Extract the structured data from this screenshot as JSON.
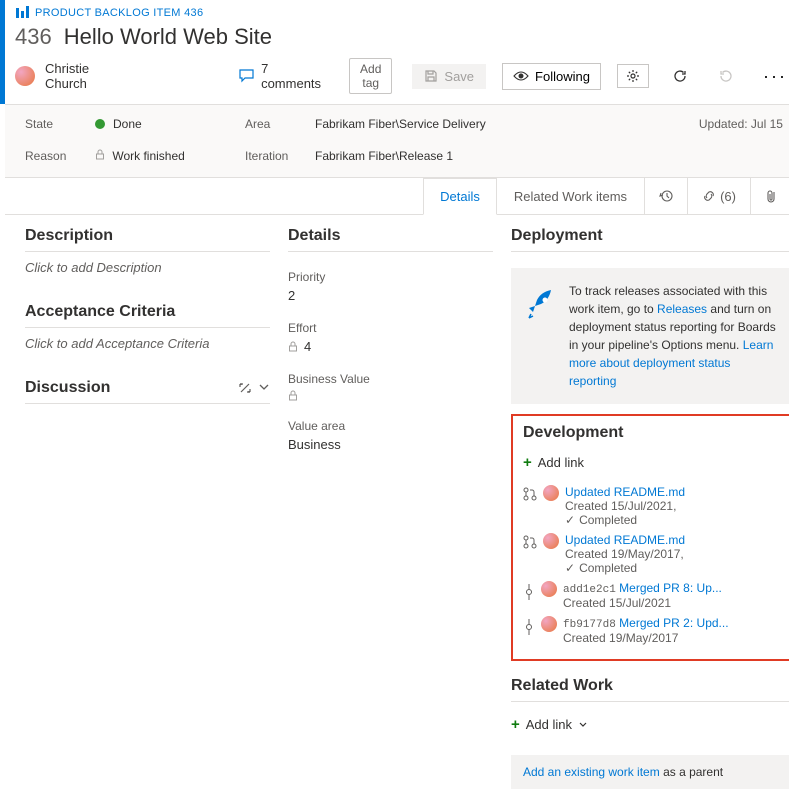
{
  "header": {
    "type_label": "PRODUCT BACKLOG ITEM 436",
    "id": "436",
    "title": "Hello World Web Site",
    "author": "Christie Church",
    "comments_count": "7 comments",
    "add_tag": "Add tag",
    "save": "Save",
    "following": "Following"
  },
  "fields": {
    "state_label": "State",
    "state_value": "Done",
    "reason_label": "Reason",
    "reason_value": "Work finished",
    "area_label": "Area",
    "area_value": "Fabrikam Fiber\\Service Delivery",
    "iteration_label": "Iteration",
    "iteration_value": "Fabrikam Fiber\\Release 1",
    "updated": "Updated: Jul 15"
  },
  "tabs": {
    "details": "Details",
    "related": "Related Work items",
    "links_count": "(6)"
  },
  "left": {
    "description_title": "Description",
    "description_placeholder": "Click to add Description",
    "acceptance_title": "Acceptance Criteria",
    "acceptance_placeholder": "Click to add Acceptance Criteria",
    "discussion_title": "Discussion"
  },
  "mid": {
    "title": "Details",
    "priority_label": "Priority",
    "priority_value": "2",
    "effort_label": "Effort",
    "effort_value": "4",
    "bv_label": "Business Value",
    "va_label": "Value area",
    "va_value": "Business"
  },
  "right": {
    "deployment_title": "Deployment",
    "deployment_text_1": "To track releases associated with this work item, go to ",
    "deployment_link_1": "Releases",
    "deployment_text_2": " and turn on deployment status reporting for Boards in your pipeline's Options menu. ",
    "deployment_link_2": "Learn more about deployment status reporting",
    "development_title": "Development",
    "add_link": "Add link",
    "items": [
      {
        "title": "Updated README.md",
        "created": "Created 15/Jul/2021,",
        "status": "Completed",
        "type": "pr"
      },
      {
        "title": "Updated README.md",
        "created": "Created 19/May/2017,",
        "status": "Completed",
        "type": "pr"
      },
      {
        "hash": "add1e2c1",
        "title": "Merged PR 8: Up...",
        "created": "Created 15/Jul/2021",
        "type": "commit"
      },
      {
        "hash": "fb9177d8",
        "title": "Merged PR 2: Upd...",
        "created": "Created 19/May/2017",
        "type": "commit"
      }
    ],
    "related_title": "Related Work",
    "add_link_dd": "Add link",
    "existing_link": "Add an existing work item",
    "existing_suffix": " as a parent"
  }
}
